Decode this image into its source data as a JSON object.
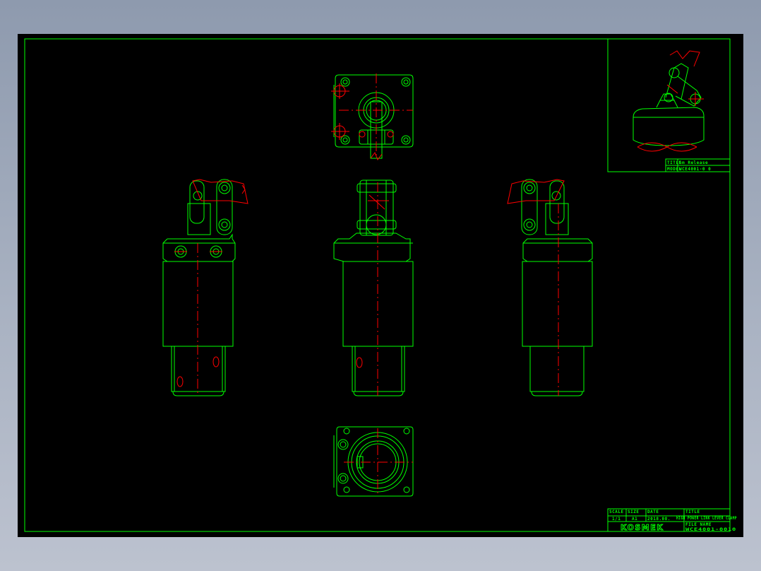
{
  "title_block": {
    "scale_label": "SCALE",
    "scale_value": "1/1",
    "size_label": "SIZE",
    "size_value": "A1",
    "date_label": "DATE",
    "date_value": "2018.08.",
    "title_label": "TITLE",
    "title_value": "HIGH POWER LINK LEVER CLAMP",
    "file_label": "FILE NAME",
    "file_value": "WCE4001-0010",
    "company_logo_text": "KOSMEK"
  },
  "preview_block": {
    "title_label": "TITLE",
    "title_value": "Sm Release",
    "model_label": "MODEL",
    "model_value": "WCE4001-0 0"
  },
  "colors": {
    "background": "#000000",
    "outline": "#00ff00",
    "centerline": "#ff0000"
  }
}
